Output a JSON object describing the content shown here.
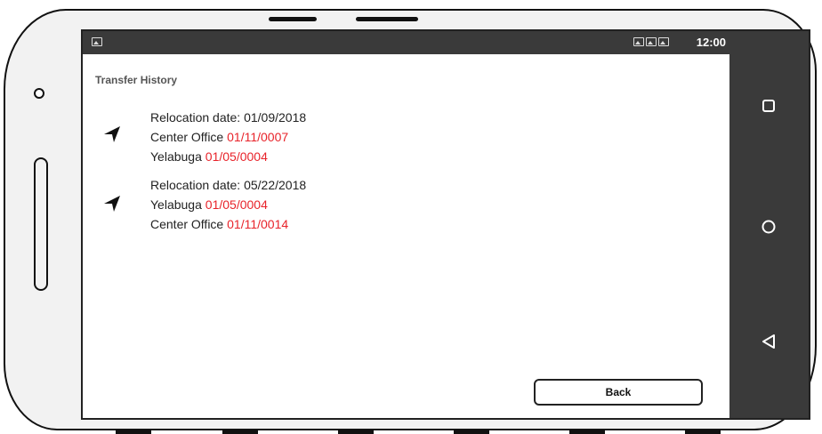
{
  "statusbar": {
    "time": "12:00"
  },
  "header": {
    "title": "Transfer History"
  },
  "transfers": [
    {
      "date_line": "Relocation date: 01/09/2018",
      "moves": [
        {
          "place": "Center Office",
          "code": "01/11/0007"
        },
        {
          "place": "Yelabuga",
          "code": "01/05/0004"
        }
      ]
    },
    {
      "date_line": "Relocation date: 05/22/2018",
      "moves": [
        {
          "place": "Yelabuga",
          "code": "01/05/0004"
        },
        {
          "place": "Center Office",
          "code": "01/11/0014"
        }
      ]
    }
  ],
  "actions": {
    "back_label": "Back"
  },
  "icons": {
    "transfer": "navigation-arrow-icon",
    "status_left": "image-icon",
    "status_right": [
      "image-icon",
      "image-icon",
      "image-icon"
    ],
    "nav": [
      "square-icon",
      "circle-icon",
      "back-triangle-icon"
    ]
  },
  "colors": {
    "code": "#e8232a",
    "bars": "#3a3a3a"
  }
}
